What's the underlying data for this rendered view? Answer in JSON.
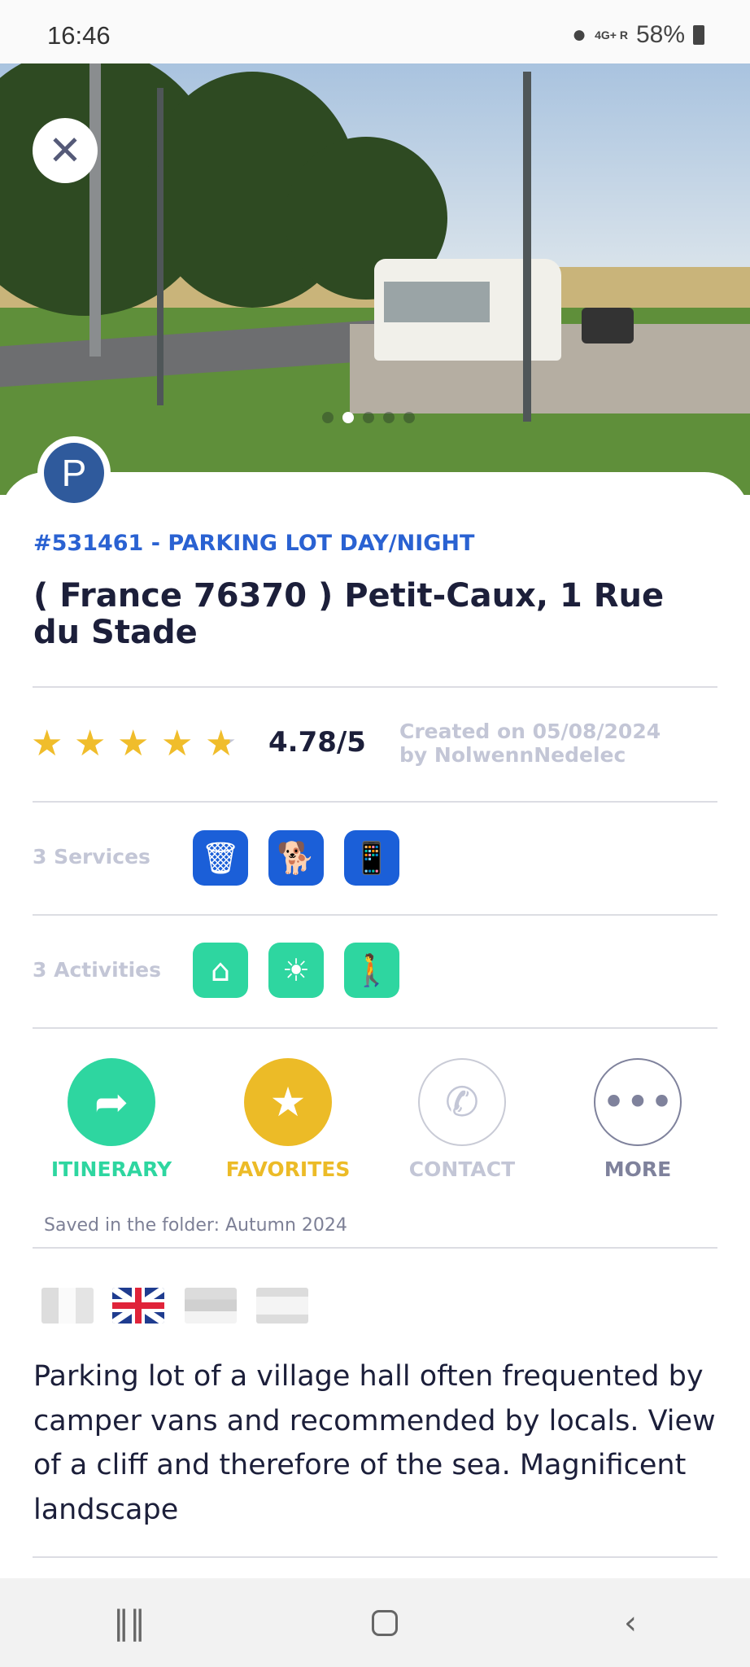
{
  "status_bar": {
    "time": "16:46",
    "network": "4G+ R",
    "battery": "58%"
  },
  "photo": {
    "slides": 5,
    "active_slide": 2
  },
  "place": {
    "id_type": "#531461 - PARKING LOT DAY/NIGHT",
    "title": "( France 76370 ) Petit-Caux, 1 Rue du Stade",
    "category_badge": "P"
  },
  "rating": {
    "value": "4.78/5",
    "stars": 4.78,
    "created": "Created on 05/08/2024",
    "author": "by NolwennNedelec"
  },
  "services": {
    "label": "3 Services",
    "icons": [
      "trash-bin-icon",
      "dog-icon",
      "mobile-network-icon"
    ]
  },
  "activities": {
    "label": "3 Activities",
    "icons": [
      "playground-icon",
      "viewpoint-icon",
      "hiking-icon"
    ]
  },
  "actions": [
    {
      "label": "ITINERARY",
      "color": "#2ed6a0"
    },
    {
      "label": "FAVORITES",
      "color": "#ecbb27"
    },
    {
      "label": "CONTACT",
      "color": "#c3c6d6"
    },
    {
      "label": "MORE",
      "color": "#7f829c"
    }
  ],
  "saved_folder": "Saved in the folder: Autumn 2024",
  "languages": [
    "French",
    "English",
    "German",
    "Spanish"
  ],
  "active_language": "English",
  "description": "Parking lot of a village hall often frequented by camper vans and recommended by locals. View of a cliff and therefore of the sea. Magnificent landscape",
  "colors": {
    "brand_blue": "#2a62d2",
    "star": "#f0bd2b",
    "text": "#1c1f3a"
  }
}
